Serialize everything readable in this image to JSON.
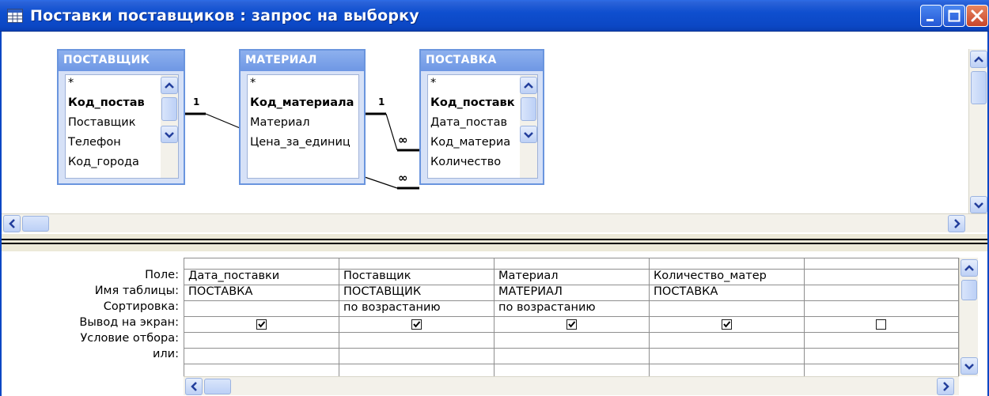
{
  "window": {
    "title": "Поставки поставщиков : запрос на выборку"
  },
  "tables": [
    {
      "name": "ПОСТАВЩИК",
      "fields": [
        "*",
        "Код_постав",
        "Поставщик",
        "Телефон",
        "Код_города"
      ],
      "primary_key": "Код_постав"
    },
    {
      "name": "МАТЕРИАЛ",
      "fields": [
        "*",
        "Код_материала",
        "Материал",
        "Цена_за_единиц"
      ],
      "primary_key": "Код_материала"
    },
    {
      "name": "ПОСТАВКА",
      "fields": [
        "*",
        "Код_поставк",
        "Дата_постав",
        "Код_материа",
        "Количество"
      ],
      "primary_key": "Код_поставк"
    }
  ],
  "relationships": [
    {
      "one_side": "1",
      "many_side": "∞"
    },
    {
      "one_side": "1",
      "many_side": "∞"
    }
  ],
  "grid": {
    "row_labels": [
      "Поле:",
      "Имя таблицы:",
      "Сортировка:",
      "Вывод на экран:",
      "Условие отбора:",
      "или:"
    ],
    "columns": [
      {
        "field": "Дата_поставки",
        "table": "ПОСТАВКА",
        "sort": "",
        "show": true
      },
      {
        "field": "Поставщик",
        "table": "ПОСТАВЩИК",
        "sort": "по возрастанию",
        "show": true
      },
      {
        "field": "Материал",
        "table": "МАТЕРИАЛ",
        "sort": "по возрастанию",
        "show": true
      },
      {
        "field": "Количество_матер",
        "table": "ПОСТАВКА",
        "sort": "",
        "show": true
      },
      {
        "field": "",
        "table": "",
        "sort": "",
        "show": false
      }
    ]
  },
  "colors": {
    "titlebar": "#0B47C4",
    "table_header": "#7A9FE8",
    "window_bg": "#ECE9D8"
  }
}
